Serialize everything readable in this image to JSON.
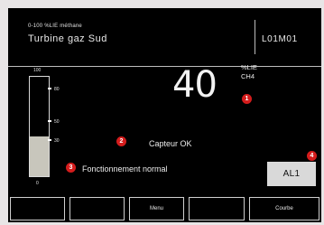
{
  "header": {
    "range_label": "0-100 %LIE méthane",
    "station_name": "Turbine gaz Sud",
    "code": "L01M01"
  },
  "gauge": {
    "level_fraction": 0.4,
    "scale": [
      "100",
      "80",
      "50",
      "30",
      "0"
    ]
  },
  "reading": {
    "value": "40",
    "unit": "%LIE",
    "gas": "CH4"
  },
  "status": {
    "sensor": "Capteur OK",
    "operation": "Fonctionnement normal"
  },
  "alarm": {
    "label": "AL1"
  },
  "badges": [
    "1",
    "2",
    "3",
    "4"
  ],
  "softkeys": [
    "",
    "",
    "Menu",
    "",
    "Courbe"
  ],
  "colors": {
    "screen_bg": "#000000",
    "bezel": "#e8e5e6",
    "badge": "#d41c1c",
    "gauge_fill": "#c8c6bc",
    "alarm_bg": "#d9d9d9"
  }
}
